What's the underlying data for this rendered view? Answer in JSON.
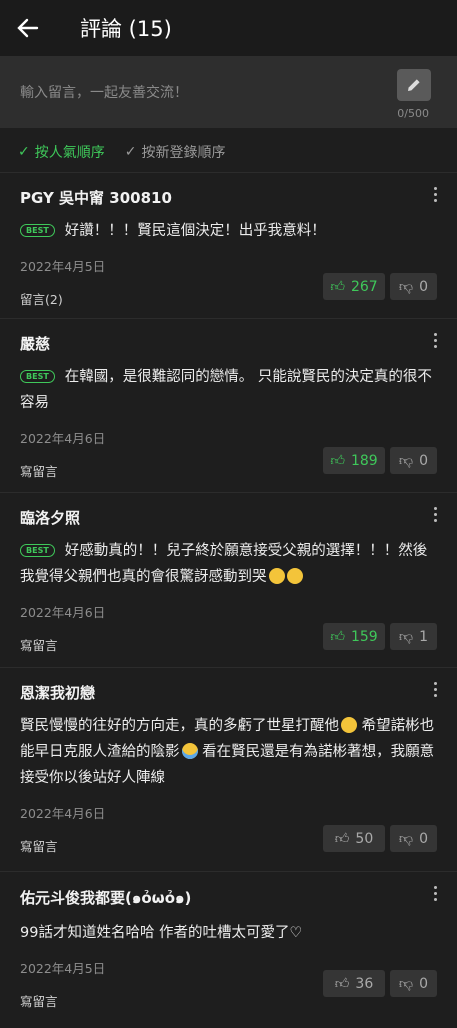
{
  "header": {
    "title": "評論 (15)"
  },
  "input": {
    "placeholder": "輸入留言，一起友善交流！",
    "counter": "0/500"
  },
  "sort": {
    "popular": "按人氣順序",
    "newest": "按新登錄順序"
  },
  "best_label": "BEST",
  "comments": [
    {
      "user": "PGY 吳中甯 300810",
      "best": true,
      "text": "好讚！！！賢民這個決定！出乎我意料！",
      "date": "2022年4月5日",
      "reply": "留言(2)",
      "likes": "267",
      "dislikes": "0",
      "hot": true
    },
    {
      "user": "嚴慈",
      "best": true,
      "text": "在韓國，是很難認同的戀情。 只能說賢民的決定真的很不容易",
      "date": "2022年4月6日",
      "reply": "寫留言",
      "likes": "189",
      "dislikes": "0",
      "hot": true
    },
    {
      "user": "臨洛夕照",
      "best": true,
      "text": "好感動真的！！兒子終於願意接受父親的選擇！！！然後我覺得父親們也真的會很驚訝感動到哭",
      "date": "2022年4月6日",
      "reply": "寫留言",
      "likes": "159",
      "dislikes": "1",
      "hot": true
    },
    {
      "user": "恩潔我初戀",
      "best": false,
      "text": "賢民慢慢的往好的方向走，真的多虧了世星打醒他",
      "text2": " 希望諾彬也能早日克服人渣給的陰影",
      "text3": " 看在賢民還是有為諾彬著想，我願意接受你以後站好人陣線",
      "date": "2022年4月6日",
      "reply": "寫留言",
      "likes": "50",
      "dislikes": "0",
      "hot": false
    },
    {
      "user": "佑元斗俊我都要(๑ỏѡỏ๑)",
      "best": false,
      "text": "99話才知道姓名哈哈 作者的吐槽太可愛了♡",
      "date": "2022年4月5日",
      "reply": "寫留言",
      "likes": "36",
      "dislikes": "0",
      "hot": false
    }
  ],
  "colors": {
    "accent": "#3fc85a",
    "background": "#1e1e1e"
  }
}
